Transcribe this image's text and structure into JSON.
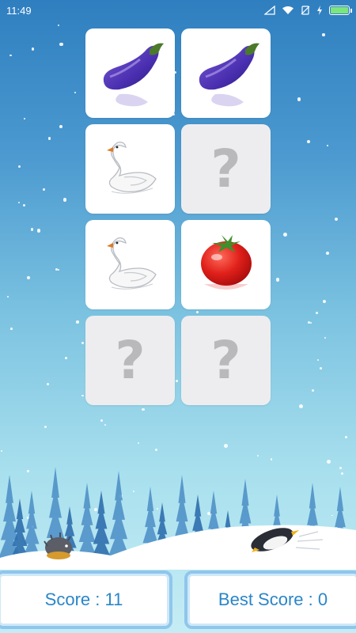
{
  "status_bar": {
    "time": "11:49",
    "icons": [
      "signal-icon",
      "wifi-icon",
      "no-sim-icon",
      "charging-icon",
      "battery-icon"
    ],
    "battery_color": "#7ce57c"
  },
  "board": {
    "columns": 2,
    "rows": 4,
    "cards": [
      {
        "state": "revealed",
        "icon": "eggplant"
      },
      {
        "state": "revealed",
        "icon": "eggplant"
      },
      {
        "state": "revealed",
        "icon": "swan"
      },
      {
        "state": "hidden",
        "symbol": "?"
      },
      {
        "state": "revealed",
        "icon": "swan"
      },
      {
        "state": "revealed",
        "icon": "tomato"
      },
      {
        "state": "hidden",
        "symbol": "?"
      },
      {
        "state": "hidden",
        "symbol": "?"
      }
    ]
  },
  "scene": {
    "decorations": [
      "pine-trees",
      "snow-hill",
      "hedgehog-icon",
      "penguin-icon"
    ]
  },
  "scores": {
    "score_label": "Score : 11",
    "best_score_label": "Best Score : 0"
  },
  "colors": {
    "score_text": "#2a86c8",
    "panel_border": "#8fc6ec",
    "hidden_card": "#ededef",
    "question_mark": "#b9b9bb"
  }
}
